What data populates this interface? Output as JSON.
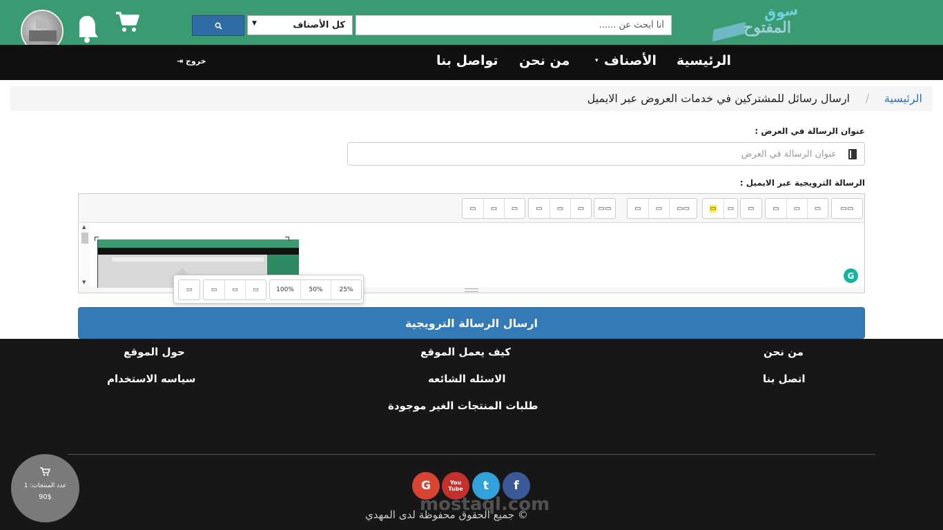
{
  "header": {
    "logo_line1": "سوق",
    "logo_line2": "المفتوح",
    "search_placeholder": "أنا أبحث عن ......",
    "category_selected": "كل الأصناف",
    "search_button_icon": "search-icon",
    "colors": {
      "header_bg": "#3a9b72",
      "search_btn": "#2f6ca6"
    }
  },
  "nav": {
    "items": [
      "الرئيسية",
      "الأصناف",
      "من نحن",
      "تواصل بنا"
    ],
    "logout": "خروج"
  },
  "breadcrumb": {
    "home": "الرئيسية",
    "separator": "/",
    "current": "ارسال رسائل للمشتركين في خدمات العروض عبر الايميل"
  },
  "form": {
    "title_label": "عنوان الرسالة في العرض :",
    "title_placeholder": "عنوان الرسالة في العرض",
    "message_label": "الرسالة الترويجية عبر الايميل :",
    "grammarly": "G",
    "image_popover": {
      "sizes": [
        "100%",
        "50%",
        "25%"
      ]
    },
    "submit": "ارسال الرسالة الترويجية"
  },
  "footer": {
    "col_right": [
      "من نحن",
      "اتصل بنا"
    ],
    "col_middle": [
      "كيف يعمل الموقع",
      "الاسئله الشائعه",
      "طلبات المنتجات الغير موجودة"
    ],
    "col_left": [
      "حول الموقع",
      "سياسه الاستخدام"
    ],
    "social": {
      "google": "G",
      "youtube": "You Tube",
      "twitter": "t",
      "facebook": "f"
    },
    "watermark": "mostaql.com",
    "copyright": "جميع الحقوق محفوظة لدى المهدي ©",
    "colors": {
      "google": "#d94333",
      "youtube": "#c4302b",
      "twitter": "#33a1d9",
      "facebook": "#3b5998"
    }
  },
  "cart_widget": {
    "count_label": "عدد المنتجات: 1",
    "total": "90$"
  }
}
